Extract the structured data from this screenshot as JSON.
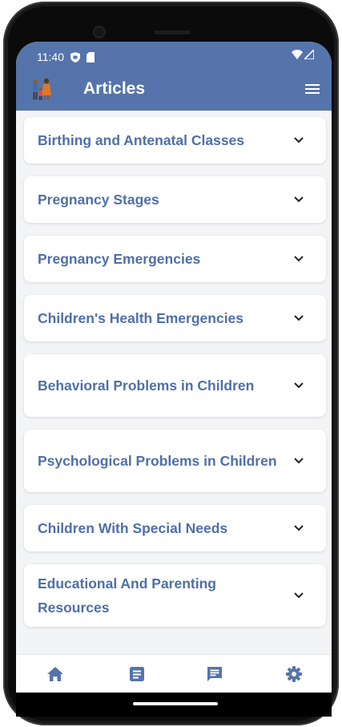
{
  "status_bar": {
    "time": "11:40"
  },
  "header": {
    "title": "Articles",
    "logo": "family-logo-icon",
    "menu_icon": "hamburger-menu-icon",
    "background_color": "#5574ab"
  },
  "articles": {
    "items": [
      {
        "label": "Birthing and Antenatal Classes"
      },
      {
        "label": "Pregnancy Stages"
      },
      {
        "label": "Pregnancy Emergencies"
      },
      {
        "label": "Children's Health Emergencies"
      },
      {
        "label": "Behavioral Problems in Children"
      },
      {
        "label": "Psychological Problems in Children"
      },
      {
        "label": "Children With Special Needs"
      },
      {
        "label": "Educational And Parenting Resources"
      }
    ],
    "title_color": "#4f6fa8"
  },
  "bottom_nav": {
    "items": [
      {
        "icon": "home-icon"
      },
      {
        "icon": "article-icon"
      },
      {
        "icon": "message-icon"
      },
      {
        "icon": "settings-gear-icon"
      }
    ]
  }
}
